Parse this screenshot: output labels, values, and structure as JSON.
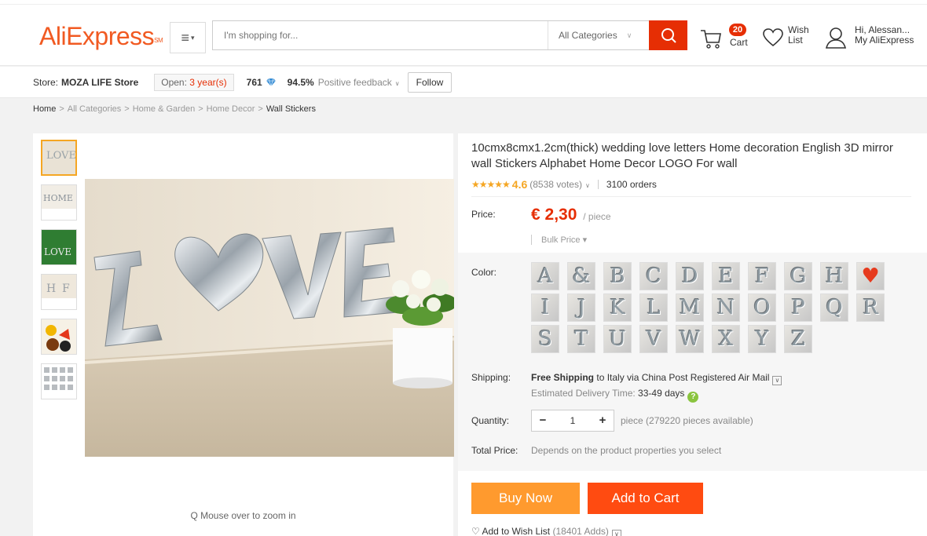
{
  "header": {
    "logo": "AliExpress",
    "logo_tm": "SM",
    "search_placeholder": "I'm shopping for...",
    "category": "All Categories",
    "cart_count": "20",
    "cart_label": "Cart",
    "wish_line1": "Wish",
    "wish_line2": "List",
    "account_line1": "Hi, Alessan...",
    "account_line2": "My AliExpress"
  },
  "store": {
    "prefix": "Store:",
    "name": "MOZA LIFE Store",
    "open_prefix": "Open:",
    "open_years": "3 year(s)",
    "score": "761",
    "feedback_pct": "94.5%",
    "feedback_label": "Positive feedback",
    "follow": "Follow"
  },
  "breadcrumb": [
    "Home",
    "All Categories",
    "Home & Garden",
    "Home Decor",
    "Wall Stickers"
  ],
  "gallery": {
    "zoom_hint": "Mouse over to zoom in",
    "main_letters": [
      "L",
      "V",
      "E"
    ]
  },
  "product": {
    "title": "10cmx8cmx1.2cm(thick) wedding love letters Home decoration English 3D mirror wall Stickers Alphabet Home Decor LOGO For wall",
    "stars": "★★★★★",
    "rating": "4.6",
    "votes": "(8538 votes)",
    "orders": "3100 orders",
    "price_label": "Price:",
    "price": "€ 2,30",
    "price_unit": "/ piece",
    "bulk": "Bulk Price ▾",
    "color_label": "Color:",
    "colors": [
      "A",
      "&",
      "B",
      "C",
      "D",
      "E",
      "F",
      "G",
      "H",
      "♥",
      "I",
      "J",
      "K",
      "L",
      "M",
      "N",
      "O",
      "P",
      "Q",
      "R",
      "S",
      "T",
      "U",
      "V",
      "W",
      "X",
      "Y",
      "Z"
    ],
    "shipping_label": "Shipping:",
    "shipping_free": "Free Shipping",
    "shipping_rest": "to Italy via China Post Registered Air Mail",
    "est_label": "Estimated Delivery Time:",
    "est_days": "33-49 days",
    "qty_label": "Quantity:",
    "qty_minus": "−",
    "qty_value": "1",
    "qty_plus": "+",
    "avail": "piece (279220 pieces available)",
    "total_label": "Total Price:",
    "total_value": "Depends on the product properties you select",
    "buy_now": "Buy Now",
    "add_to_cart": "Add to Cart",
    "wish_label": "Add to Wish List",
    "wish_count": "(18401 Adds)"
  },
  "colors": {
    "brand": "#f15a22",
    "search_button": "#e62e04",
    "price": "#e62e04",
    "buy_now": "#ff9a2e",
    "add_to_cart": "#ff4b11",
    "star": "#f5a623"
  }
}
